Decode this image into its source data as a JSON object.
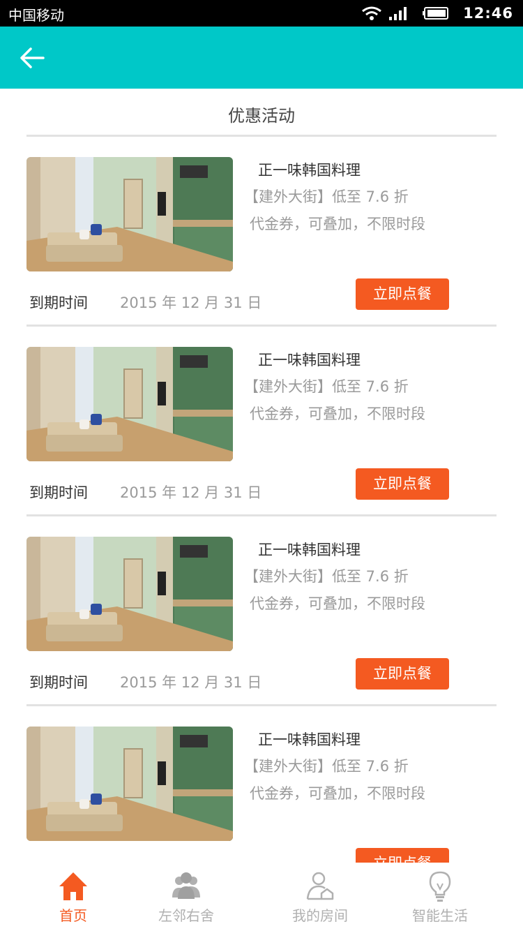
{
  "status_bar": {
    "carrier": "中国移动",
    "time": "12:46",
    "icons": [
      "wifi-icon",
      "signal-icon",
      "battery-icon"
    ]
  },
  "app_bar": {
    "back_icon": "arrow-left-icon",
    "color": "#00c8c8"
  },
  "page": {
    "title": "优惠活动"
  },
  "deals": [
    {
      "name": "正一味韩国料理",
      "discount": "【建外大街】低至 7.6 折",
      "terms": "代金券，可叠加，不限时段",
      "expiry_label": "到期时间",
      "expiry_date": "2015 年 12 月 31 日",
      "button": "立即点餐"
    },
    {
      "name": "正一味韩国料理",
      "discount": "【建外大街】低至 7.6 折",
      "terms": "代金券，可叠加，不限时段",
      "expiry_label": "到期时间",
      "expiry_date": "2015 年 12 月 31 日",
      "button": "立即点餐"
    },
    {
      "name": "正一味韩国料理",
      "discount": "【建外大街】低至 7.6 折",
      "terms": "代金券，可叠加，不限时段",
      "expiry_label": "到期时间",
      "expiry_date": "2015 年 12 月 31 日",
      "button": "立即点餐"
    },
    {
      "name": "正一味韩国料理",
      "discount": "【建外大街】低至 7.6 折",
      "terms": "代金券，可叠加，不限时段",
      "expiry_label": "到期时间",
      "expiry_date": "2015 年 12 月 31 日",
      "button": "立即点餐"
    }
  ],
  "tab_bar": {
    "tabs": [
      {
        "label": "首页",
        "icon": "home-icon",
        "active": true
      },
      {
        "label": "左邻右舍",
        "icon": "neighbors-icon",
        "active": false
      },
      {
        "label": "我的房间",
        "icon": "my-room-icon",
        "active": false
      },
      {
        "label": "智能生活",
        "icon": "lightbulb-icon",
        "active": false
      }
    ]
  },
  "colors": {
    "accent": "#00c8c8",
    "button": "#f45a21",
    "active_tab": "#f45a21",
    "inactive_tab": "#b0b0b0"
  }
}
